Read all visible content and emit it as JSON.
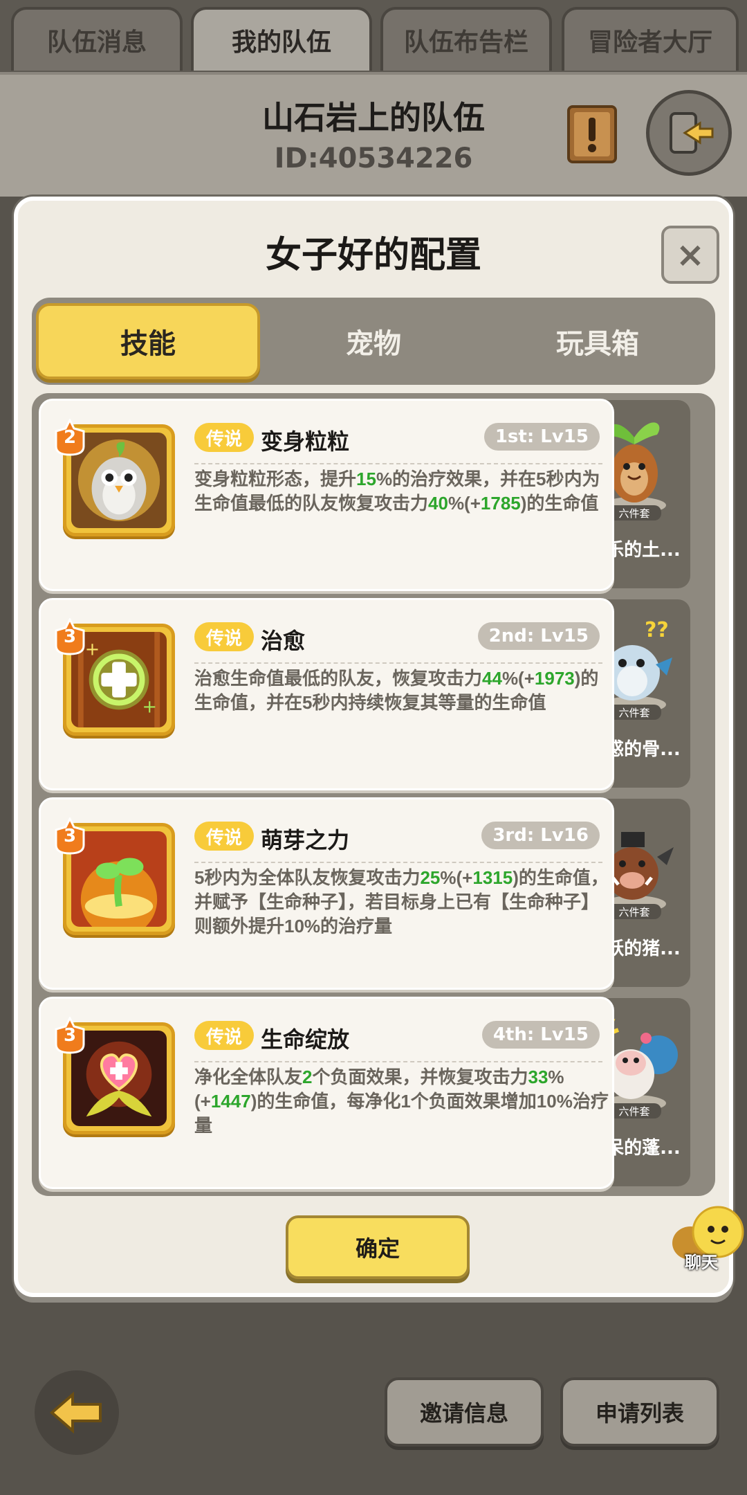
{
  "top_tabs": [
    {
      "label": "队伍消息"
    },
    {
      "label": "我的队伍"
    },
    {
      "label": "队伍布告栏"
    },
    {
      "label": "冒险者大厅"
    }
  ],
  "active_top_tab": "我的队伍",
  "team": {
    "name": "山石岩上的队伍",
    "id": "ID:40534226"
  },
  "dialog": {
    "title": "女子好的配置",
    "close_label": "×",
    "tabs": [
      {
        "label": "技能"
      },
      {
        "label": "宠物"
      },
      {
        "label": "玩具箱"
      }
    ],
    "active_tab": "技能",
    "skills": [
      {
        "level": "2",
        "rarity": "传说",
        "name": "变身粒粒",
        "order": "1st: Lv15",
        "desc": [
          {
            "t": "变身粒粒形态，提升"
          },
          {
            "t": "15",
            "hl": true
          },
          {
            "t": "%的治疗效果，并在5秒内为生命值最低的队友恢复攻击力"
          },
          {
            "t": "40",
            "hl": true
          },
          {
            "t": "%(+"
          },
          {
            "t": "1785",
            "hl": true
          },
          {
            "t": ")的生命值"
          }
        ],
        "icon": "owl-icon",
        "pet": {
          "name": "快乐的土...",
          "badge": "六件套",
          "icon": "mandrake-pet-icon"
        }
      },
      {
        "level": "3",
        "rarity": "传说",
        "name": "治愈",
        "order": "2nd: Lv15",
        "desc": [
          {
            "t": "治愈生命值最低的队友，恢复攻击力"
          },
          {
            "t": "44",
            "hl": true
          },
          {
            "t": "%(+"
          },
          {
            "t": "1973",
            "hl": true
          },
          {
            "t": ")的生命值，并在5秒内持续恢复其等量的生命值"
          }
        ],
        "icon": "heal-cross-icon",
        "pet": {
          "name": "困惑的骨...",
          "badge": "六件套",
          "icon": "confused-dragon-pet-icon"
        }
      },
      {
        "level": "3",
        "rarity": "传说",
        "name": "萌芽之力",
        "order": "3rd: Lv16",
        "desc": [
          {
            "t": "5秒内为全体队友恢复攻击力"
          },
          {
            "t": "25",
            "hl": true
          },
          {
            "t": "%(+"
          },
          {
            "t": "1315",
            "hl": true
          },
          {
            "t": ")的生命值，并赋予【生命种子】，若目标身上已有【生命种子】则额外提升10%的治疗量"
          }
        ],
        "icon": "sprout-icon",
        "pet": {
          "name": "活跃的猪...",
          "badge": "六件套",
          "icon": "boar-pet-icon"
        }
      },
      {
        "level": "3",
        "rarity": "传说",
        "name": "生命绽放",
        "order": "4th: Lv15",
        "desc": [
          {
            "t": "净化全体队友"
          },
          {
            "t": "2",
            "hl": true
          },
          {
            "t": "个负面效果，并恢复攻击力"
          },
          {
            "t": "33",
            "hl": true
          },
          {
            "t": "%(+"
          },
          {
            "t": "1447",
            "hl": true
          },
          {
            "t": ")的生命值，每净化1个负面效果增加10%治疗量"
          }
        ],
        "icon": "heart-bloom-icon",
        "pet": {
          "name": "发呆的蓬...",
          "badge": "六件套",
          "icon": "sheep-pet-icon"
        }
      }
    ],
    "confirm_label": "确定"
  },
  "chat": {
    "label": "聊天"
  },
  "bottom": {
    "invite_label": "邀请信息",
    "apply_label": "申请列表"
  },
  "colors": {
    "accent_yellow": "#f7d659",
    "highlight_green": "#2da62c",
    "rarity_gold": "#f8cb3a"
  }
}
